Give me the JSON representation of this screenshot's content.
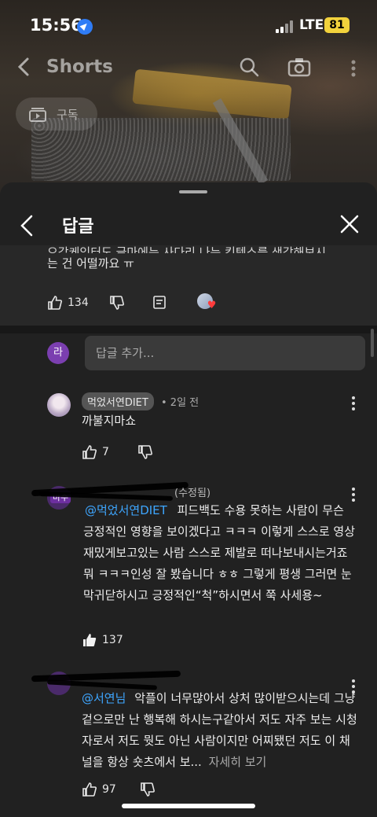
{
  "status": {
    "time": "15:56",
    "network": "LTE",
    "battery": "81"
  },
  "nav": {
    "title": "Shorts"
  },
  "chip": {
    "subscribe_label": "구독"
  },
  "sheet": {
    "title": "답글"
  },
  "parent": {
    "text_cut": "오감케익터도 글마에는 사다리 나는 킨텐스를 생각해보시",
    "text_line": "는 건 어떨까요 ㅠ",
    "likes": "134"
  },
  "reply_box": {
    "avatar_letter": "라",
    "placeholder": "답글 추가..."
  },
  "comments": [
    {
      "author": "먹었서연DIET",
      "time": "• 2일 전",
      "body": "까불지마쇼",
      "likes": "7"
    },
    {
      "author_cut": "마수",
      "edited": "(수정됨)",
      "mention": "@먹었서연DIET",
      "body": "피드백도 수용 못하는 사람이 무슨 긍정적인 영향을 보이겠다고 ㅋㅋㅋ 이렇게 스스로 영상 재밌게보고있는 사람 스스로 제발로 떠나보내시는거죠 뭐 ㅋㅋㅋ인성 잘 봤습니다 ㅎㅎ 그렇게 평생 그러면 눈막귀닫하시고 긍정적인“척”하시면서 쭉 사세용~",
      "likes": "137"
    },
    {
      "mention": "@서연님",
      "body": "악플이 너무많아서 상처 많이받으시는데 그냥 겉으로만 난 행복해 하시는구같아서 저도 자주 보는 시청자로서 저도 뭣도 아닌 사람이지만 어찌됐던 저도 이 채널을 항상 숏츠에서 보...",
      "read_more": "자세히 보기",
      "likes": "97"
    }
  ],
  "colors": {
    "sheet": "#212121",
    "link": "#3ea6ff",
    "battery": "#f2d23c"
  }
}
